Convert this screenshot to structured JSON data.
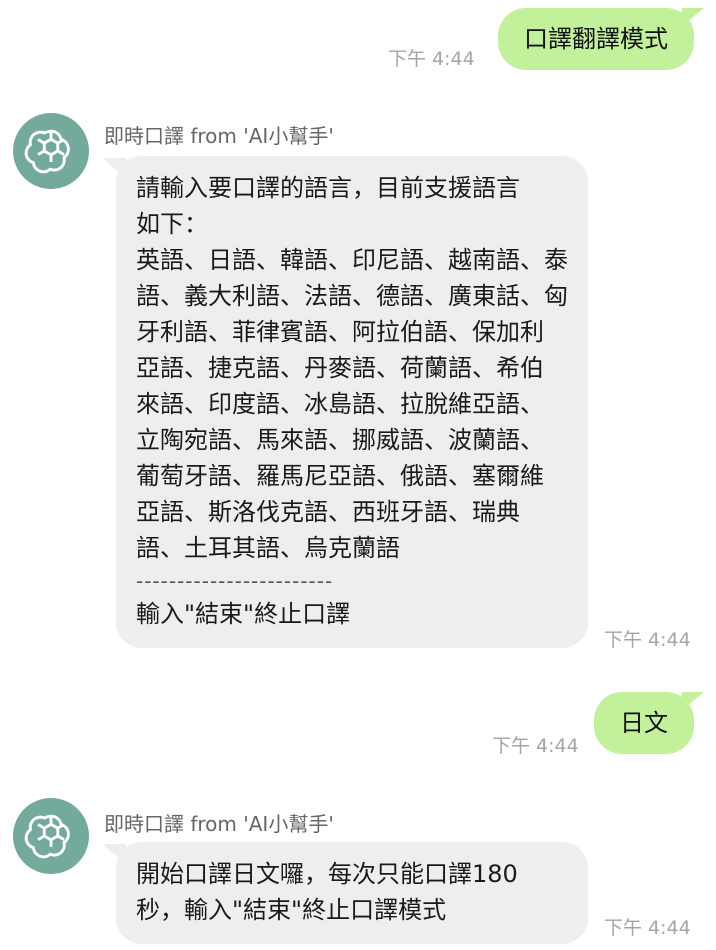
{
  "messages": [
    {
      "text": "口譯翻譯模式",
      "time": "下午 4:44"
    },
    {
      "sender": "即時口譯 from 'AI小幫手'",
      "lines": [
        "請輸入要口譯的語言，目前支援語言",
        "如下：",
        "英語、日語、韓語、印尼語、越南語、泰",
        "語、義大利語、法語、德語、廣東話、匈",
        "牙利語、菲律賓語、阿拉伯語、保加利",
        "亞語、捷克語、丹麥語、荷蘭語、希伯",
        "來語、印度語、冰島語、拉脫維亞語、",
        "立陶宛語、馬來語、挪威語、波蘭語、",
        "葡萄牙語、羅馬尼亞語、俄語、塞爾維",
        "亞語、斯洛伐克語、西班牙語、瑞典",
        "語、土耳其語、烏克蘭語"
      ],
      "divider": "------------------------",
      "footer": "輸入\"結束\"終止口譯",
      "time": "下午 4:44"
    },
    {
      "text": "日文",
      "time": "下午 4:44"
    },
    {
      "sender": "即時口譯 from 'AI小幫手'",
      "lines": [
        "開始口譯日文囉，每次只能口譯180",
        "秒，輸入\"結束\"終止口譯模式"
      ],
      "time": "下午 4:44"
    }
  ],
  "avatar_icon": "openai-logo-icon",
  "colors": {
    "outgoing_bubble": "#c3f09a",
    "incoming_bubble": "#eeeeee",
    "avatar_bg": "#74aa9c",
    "timestamp": "#a5a5a5"
  }
}
